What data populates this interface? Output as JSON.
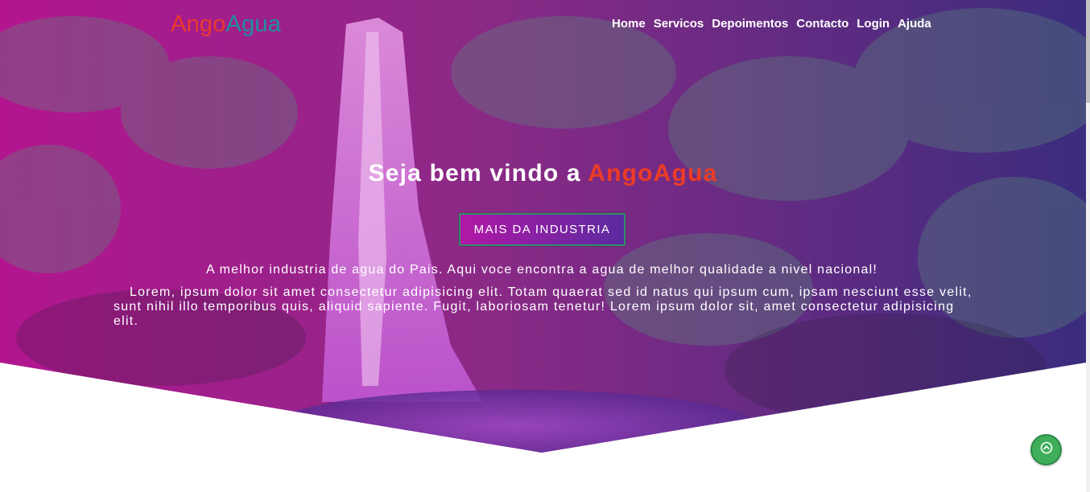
{
  "header": {
    "logo_part1": "Ango",
    "logo_part2": "Agua",
    "nav": [
      "Home",
      "Servicos",
      "Depoimentos",
      "Contacto",
      "Login",
      "Ajuda"
    ]
  },
  "hero": {
    "welcome_prefix": "Seja bem vindo a ",
    "welcome_brand": "AngoAgua",
    "cta_label": "MAIS DA INDUSTRIA",
    "lead": "A melhor industria de agua do Pais. Aqui voce encontra a agua de melhor qualidade a nivel nacional!",
    "body": "Lorem, ipsum dolor sit amet consectetur adipisicing elit. Totam quaerat sed id natus qui ipsum cum, ipsam nesciunt esse velit, sunt nihil illo temporibus quis, aliquid sapiente. Fugit, laboriosam tenetur! Lorem ipsum dolor sit, amet consectetur adipisicing elit."
  },
  "scroll_top": {
    "icon": "chevron-up-circle-icon"
  },
  "colors": {
    "logo_red": "#ea3a2c",
    "logo_teal": "#1f8f9d",
    "overlay_magenta": "#b0189a",
    "overlay_indigo": "#3a2a8a",
    "scroll_button_green": "#3fae5a"
  }
}
